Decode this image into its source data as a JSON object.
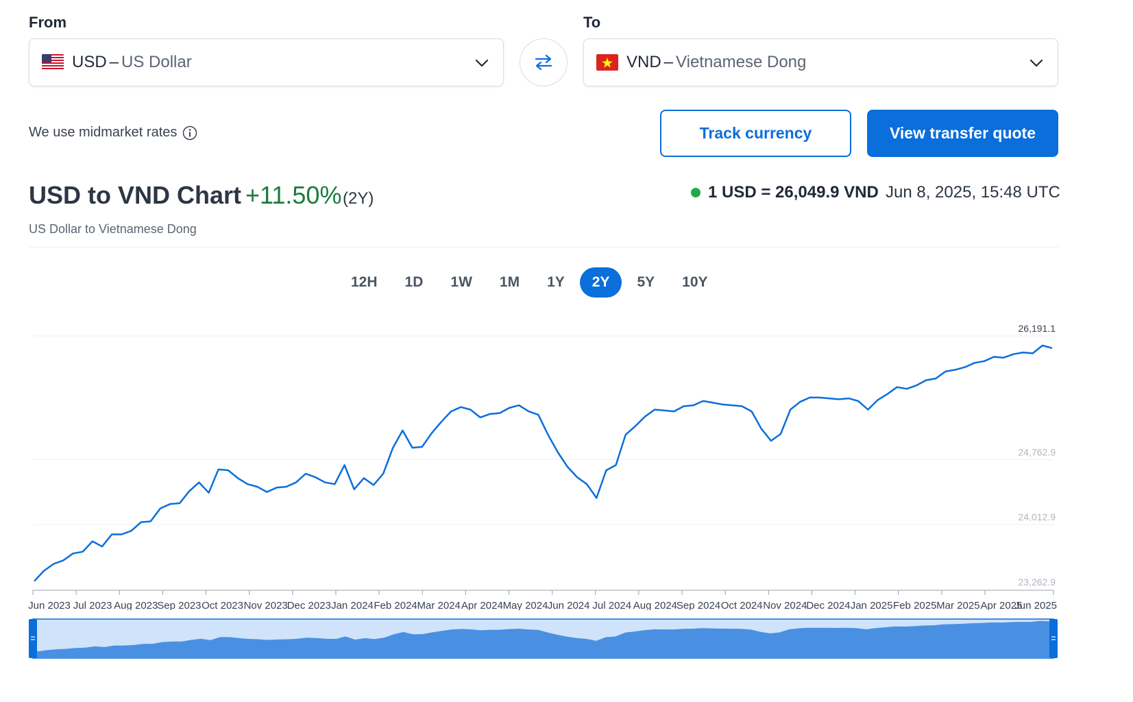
{
  "from": {
    "label": "From",
    "code": "USD",
    "dash": "–",
    "name": "US Dollar",
    "flag_icon": "us-flag-icon"
  },
  "to": {
    "label": "To",
    "code": "VND",
    "dash": "–",
    "name": "Vietnamese Dong",
    "flag_icon": "vn-flag-icon"
  },
  "midmarket_text": "We use midmarket rates",
  "buttons": {
    "track": "Track currency",
    "quote": "View transfer quote"
  },
  "chart_header": {
    "title": "USD to VND Chart",
    "change": "+11.50%",
    "period": "(2Y)",
    "subtitle": "US Dollar to Vietnamese Dong"
  },
  "rate": {
    "value": "1 USD = 26,049.9 VND",
    "timestamp": "Jun 8, 2025, 15:48 UTC",
    "status_color": "#1faa4a"
  },
  "periods": [
    "12H",
    "1D",
    "1W",
    "1M",
    "1Y",
    "2Y",
    "5Y",
    "10Y"
  ],
  "active_period": "2Y",
  "colors": {
    "accent": "#0a6edb",
    "positive": "#1b7a3a",
    "line": "#0a6edb",
    "navigator_fill": "#4a90e2"
  },
  "chart_data": {
    "type": "line",
    "title": "",
    "xlabel": "",
    "ylabel": "",
    "ylim": [
      23262.9,
      26191.1
    ],
    "y_ticks": [
      {
        "value": 23262.9,
        "label": "23,262.9"
      },
      {
        "value": 24012.9,
        "label": "24,012.9"
      },
      {
        "value": 24762.9,
        "label": "24,762.9"
      },
      {
        "value": 26191.1,
        "label": "26,191.1"
      }
    ],
    "x_ticks": [
      "Jun 2023",
      "Jul 2023",
      "Aug 2023",
      "Sep 2023",
      "Oct 2023",
      "Nov 2023",
      "Dec 2023",
      "Jan 2024",
      "Feb 2024",
      "Mar 2024",
      "Apr 2024",
      "May 2024",
      "Jun 2024",
      "Jul 2024",
      "Aug 2024",
      "Sep 2024",
      "Oct 2024",
      "Nov 2024",
      "Dec 2024",
      "Jan 2025",
      "Feb 2025",
      "Mar 2025",
      "Apr 2025",
      "Jun 2025"
    ],
    "series": [
      {
        "values": [
          23360,
          23480,
          23560,
          23600,
          23680,
          23700,
          23820,
          23760,
          23900,
          23900,
          23940,
          24040,
          24050,
          24200,
          24250,
          24260,
          24400,
          24500,
          24380,
          24650,
          24640,
          24550,
          24480,
          24450,
          24390,
          24440,
          24450,
          24500,
          24600,
          24560,
          24500,
          24480,
          24700,
          24420,
          24550,
          24470,
          24600,
          24900,
          25100,
          24900,
          24910,
          25070,
          25200,
          25320,
          25370,
          25340,
          25250,
          25290,
          25300,
          25360,
          25390,
          25320,
          25280,
          25050,
          24850,
          24680,
          24560,
          24480,
          24320,
          24640,
          24700,
          25050,
          25150,
          25260,
          25340,
          25330,
          25320,
          25380,
          25390,
          25440,
          25420,
          25400,
          25390,
          25380,
          25320,
          25120,
          24980,
          25060,
          25340,
          25430,
          25480,
          25480,
          25470,
          25460,
          25470,
          25440,
          25340,
          25450,
          25520,
          25600,
          25580,
          25620,
          25680,
          25700,
          25780,
          25800,
          25830,
          25880,
          25900,
          25950,
          25940,
          25980,
          26000,
          25990,
          26080,
          26049.9
        ]
      }
    ]
  }
}
